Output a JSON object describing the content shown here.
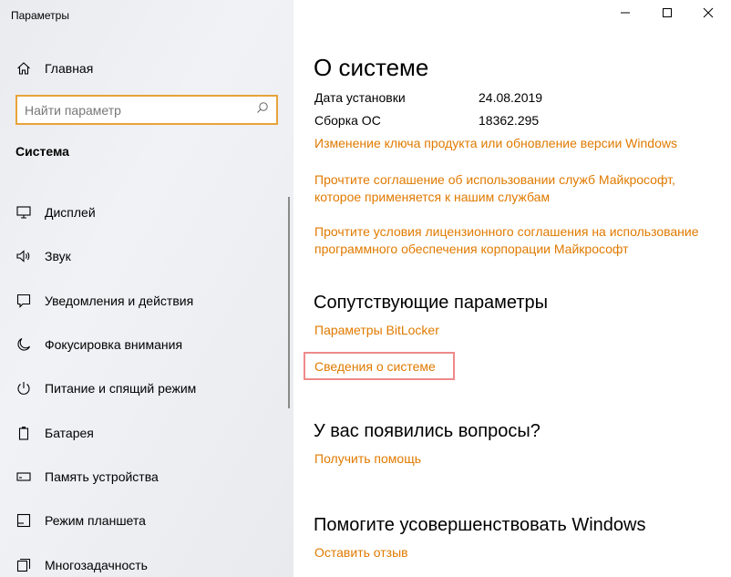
{
  "window": {
    "title": "Параметры",
    "controls": [
      "minimize-icon",
      "maximize-icon",
      "close-icon"
    ]
  },
  "sidebar": {
    "home_label": "Главная",
    "home_icon": "home-icon",
    "search": {
      "placeholder": "Найти параметр",
      "icon": "search-icon"
    },
    "section_title": "Система",
    "items": [
      {
        "label": "Дисплей",
        "icon": "display-icon"
      },
      {
        "label": "Звук",
        "icon": "sound-icon"
      },
      {
        "label": "Уведомления и действия",
        "icon": "notifications-icon"
      },
      {
        "label": "Фокусировка внимания",
        "icon": "moon-icon"
      },
      {
        "label": "Питание и спящий режим",
        "icon": "power-icon"
      },
      {
        "label": "Батарея",
        "icon": "battery-icon"
      },
      {
        "label": "Память устройства",
        "icon": "storage-icon"
      },
      {
        "label": "Режим планшета",
        "icon": "tablet-icon"
      },
      {
        "label": "Многозадачность",
        "icon": "multitasking-icon"
      }
    ]
  },
  "main": {
    "title": "О системе",
    "specs": [
      {
        "label": "Дата установки",
        "value": "24.08.2019"
      },
      {
        "label": "Сборка ОС",
        "value": "18362.295"
      }
    ],
    "links": {
      "product_key": "Изменение ключа продукта или обновление версии Windows",
      "services_agreement": "Прочтите соглашение об использовании служб Майкрософт,\nкоторое применяется к нашим службам",
      "license_terms": "Прочтите условия лицензионного соглашения на использование\nпрограммного обеспечения корпорации Майкрософт"
    },
    "related": {
      "title": "Сопутствующие параметры",
      "bitlocker": "Параметры BitLocker",
      "system_info": "Сведения о системе"
    },
    "questions": {
      "title": "У вас появились вопросы?",
      "help": "Получить помощь"
    },
    "improve": {
      "title": "Помогите усовершенствовать Windows",
      "feedback": "Оставить отзыв"
    }
  },
  "colors": {
    "accent_link": "#e07a00",
    "search_border": "#e8a33a",
    "highlight_box": "#ee8a8a"
  }
}
